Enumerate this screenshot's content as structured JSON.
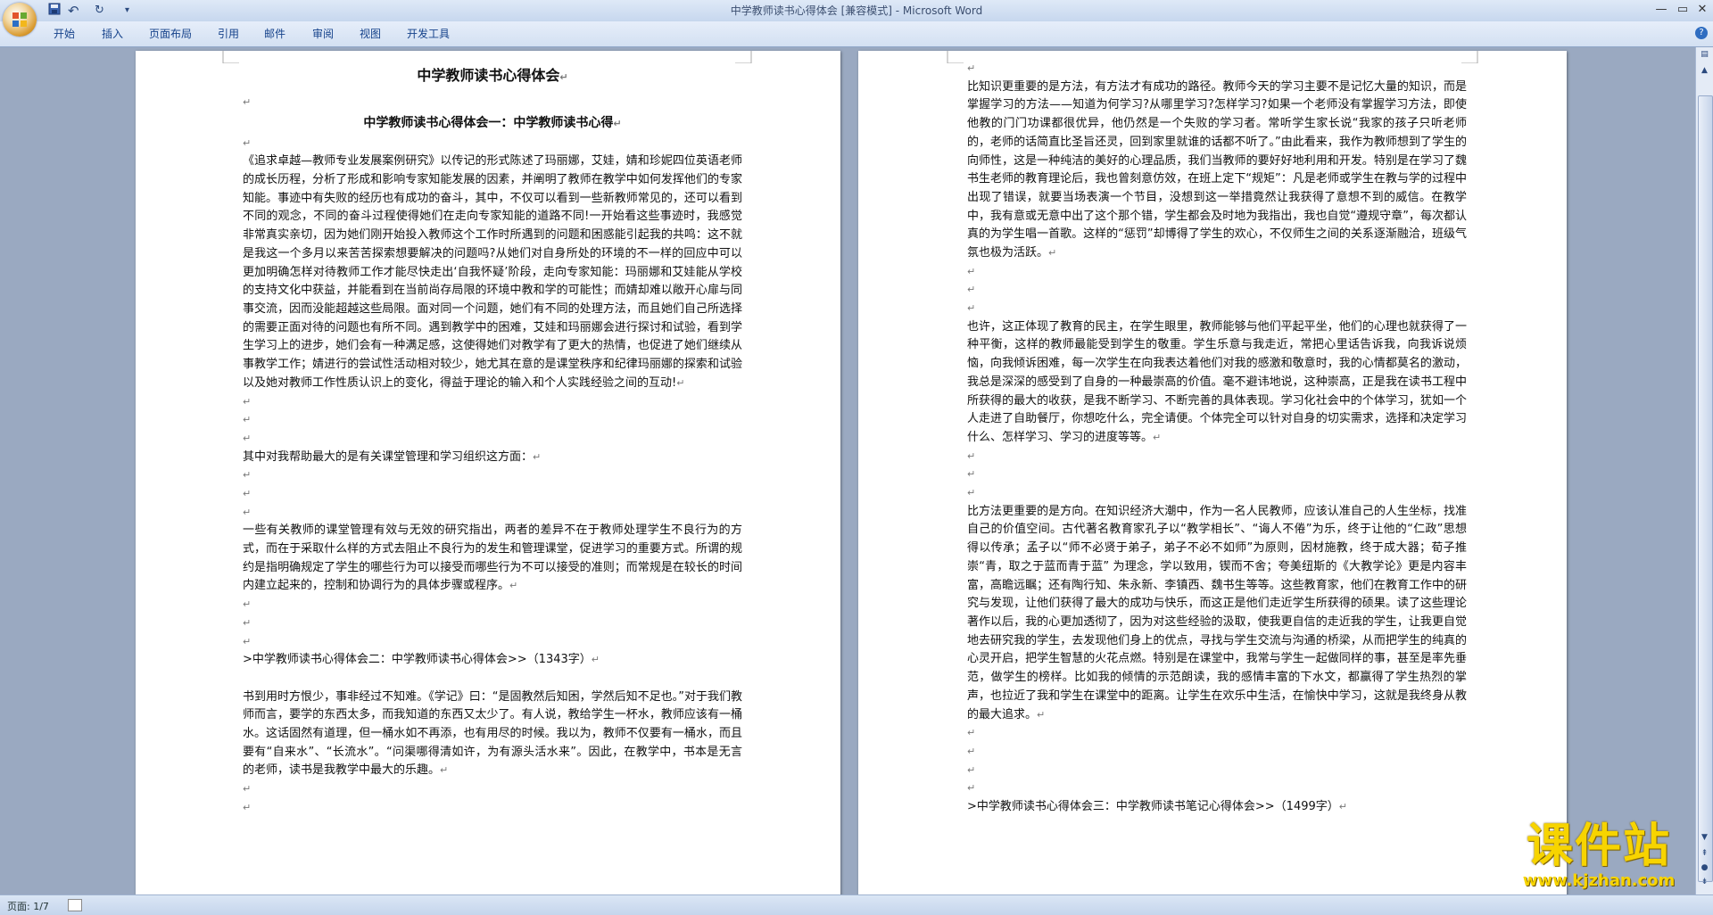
{
  "window": {
    "title": "中学教师读书心得体会 [兼容模式] - Microsoft Word"
  },
  "quick_access": {
    "undo_symbol": "↶",
    "redo_symbol": "↻",
    "more_symbol": "▾"
  },
  "window_buttons": {
    "minimize": "—",
    "maximize": "▭",
    "close": "✕"
  },
  "ribbon": {
    "tabs": [
      "开始",
      "插入",
      "页面布局",
      "引用",
      "邮件",
      "审阅",
      "视图",
      "开发工具"
    ],
    "help": "?"
  },
  "paragraph_mark": "↵",
  "document": {
    "title": "中学教师读书心得体会",
    "subtitle": "中学教师读书心得体会一：中学教师读书心得",
    "page1": {
      "p1": "《追求卓越—教师专业发展案例研究》以传记的形式陈述了玛丽娜，艾娃，婧和珍妮四位英语老师的成长历程，分析了形成和影响专家知能发展的因素，并阐明了教师在教学中如何发挥他们的专家知能。事迹中有失败的经历也有成功的奋斗，其中，不仅可以看到一些新教师常见的，还可以看到不同的观念，不同的奋斗过程使得她们在走向专家知能的道路不同!一开始看这些事迹时，我感觉非常真实亲切，因为她们刚开始投入教师这个工作时所遇到的问题和困惑能引起我的共鸣：这不就是我这一个多月以来苦苦探索想要解决的问题吗?从她们对自身所处的环境的不一样的回应中可以更加明确怎样对待教师工作才能尽快走出‘自我怀疑’阶段，走向专家知能：玛丽娜和艾娃能从学校的支持文化中获益，并能看到在当前尚存局限的环境中教和学的可能性；而婧却难以敞开心扉与同事交流，因而没能超越这些局限。面对同一个问题，她们有不同的处理方法，而且她们自己所选择的需要正面对待的问题也有所不同。遇到教学中的困难，艾娃和玛丽娜会进行探讨和试验，看到学生学习上的进步，她们会有一种满足感，这使得她们对教学有了更大的热情，也促进了她们继续从事教学工作；婧进行的尝试性活动相对较少，她尤其在意的是课堂秩序和纪律玛丽娜的探索和试验以及她对教师工作性质认识上的变化，得益于理论的输入和个人实践经验之间的互动!",
      "p2": "其中对我帮助最大的是有关课堂管理和学习组织这方面：",
      "p3": "一些有关教师的课堂管理有效与无效的研究指出，两者的差异不在于教师处理学生不良行为的方式，而在于采取什么样的方式去阻止不良行为的发生和管理课堂，促进学习的重要方式。所谓的规约是指明确规定了学生的哪些行为可以接受而哪些行为不可以接受的准则；而常规是在较长的时间内建立起来的，控制和协调行为的具体步骤或程序。",
      "p4": ">中学教师读书心得体会二：中学教师读书心得体会>>（1343字）",
      "p5": "书到用时方恨少，事非经过不知难。《学记》曰：“是固教然后知困，学然后知不足也。”对于我们教师而言，要学的东西太多，而我知道的东西又太少了。有人说，教给学生一杯水，教师应该有一桶水。这话固然有道理，但一桶水如不再添，也有用尽的时候。我以为，教师不仅要有一桶水，而且要有“自来水”、“长流水”。“问渠哪得清如许，为有源头活水来”。因此，在教学中，书本是无言的老师，读书是我教学中最大的乐趣。"
    },
    "page2": {
      "p1": "比知识更重要的是方法，有方法才有成功的路径。教师今天的学习主要不是记忆大量的知识，而是掌握学习的方法——知道为何学习?从哪里学习?怎样学习?如果一个老师没有掌握学习方法，即使他教的门门功课都很优异，他仍然是一个失败的学习者。常听学生家长说“我家的孩子只听老师的，老师的话简直比圣旨还灵，回到家里就谁的话都不听了。”由此看来，我作为教师想到了学生的向师性，这是一种纯洁的美好的心理品质，我们当教师的要好好地利用和开发。特别是在学习了魏书生老师的教育理论后，我也曾刻意仿效，在班上定下“规矩”：凡是老师或学生在教与学的过程中出现了错误，就要当场表演一个节目，没想到这一举措竟然让我获得了意想不到的威信。在教学中，我有意或无意中出了这个那个错，学生都会及时地为我指出，我也自觉“遵规守章”，每次都认真的为学生唱一首歌。这样的“惩罚”却博得了学生的欢心，不仅师生之间的关系逐渐融洽，班级气氛也极为活跃。",
      "p2": "也许，这正体现了教育的民主，在学生眼里，教师能够与他们平起平坐，他们的心理也就获得了一种平衡，这样的教师最能受到学生的敬重。学生乐意与我走近，常把心里话告诉我，向我诉说烦恼，向我倾诉困难，每一次学生在向我表达着他们对我的感激和敬意时，我的心情都莫名的激动，我总是深深的感受到了自身的一种最崇高的价值。毫不避讳地说，这种崇高，正是我在读书工程中所获得的最大的收获，是我不断学习、不断完善的具体表现。学习化社会中的个体学习，犹如一个人走进了自助餐厅，你想吃什么，完全请便。个体完全可以针对自身的切实需求，选择和决定学习什么、怎样学习、学习的进度等等。",
      "p3": "比方法更重要的是方向。在知识经济大潮中，作为一名人民教师，应该认准自己的人生坐标，找准自己的价值空间。古代著名教育家孔子以“教学相长”、“诲人不倦”为乐，终于让他的“仁政”思想得以传承；孟子以“师不必贤于弟子，弟子不必不如师”为原则，因材施教，终于成大器；荀子推崇“青，取之于蓝而青于蓝” 为理念，学以致用，锲而不舍；夸美纽斯的《大教学论》更是内容丰富，高瞻远瞩；还有陶行知、朱永新、李镇西、魏书生等等。这些教育家，他们在教育工作中的研究与发现，让他们获得了最大的成功与快乐，而这正是他们走近学生所获得的硕果。读了这些理论著作以后，我的心更加透彻了，因为对这些经验的汲取，使我更自信的走近我的学生，让我更自觉地去研究我的学生，去发现他们身上的优点，寻找与学生交流与沟通的桥梁，从而把学生的纯真的心灵开启，把学生智慧的火花点燃。特别是在课堂中，我常与学生一起做同样的事，甚至是率先垂范，做学生的榜样。比如我的倾情的示范朗读，我的感情丰富的下水文，都赢得了学生热烈的掌声，也拉近了我和学生在课堂中的距离。让学生在欢乐中生活，在愉快中学习，这就是我终身从教的最大追求。",
      "p4": ">中学教师读书心得体会三：中学教师读书笔记心得体会>>（1499字）"
    }
  },
  "status": {
    "page": "页面: 1/7"
  },
  "watermark": {
    "main": "课件站",
    "url": "www.kjzhan.com"
  }
}
